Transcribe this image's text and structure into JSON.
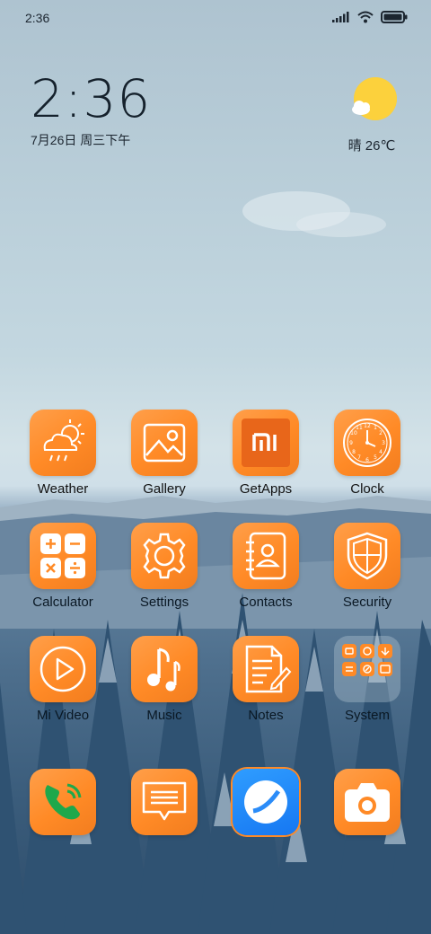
{
  "status_bar": {
    "time": "2:36",
    "icons": [
      "signal-icon",
      "wifi-icon",
      "battery-icon"
    ]
  },
  "clock_widget": {
    "time": "2:36",
    "date": "7月26日 周三下午"
  },
  "weather_widget": {
    "icon": "sun-cloud-icon",
    "text": "晴 26℃"
  },
  "apps": [
    {
      "label": "Weather",
      "icon": "weather-icon"
    },
    {
      "label": "Gallery",
      "icon": "gallery-icon"
    },
    {
      "label": "GetApps",
      "icon": "getapps-icon"
    },
    {
      "label": "Clock",
      "icon": "clock-icon"
    },
    {
      "label": "Calculator",
      "icon": "calculator-icon"
    },
    {
      "label": "Settings",
      "icon": "settings-icon"
    },
    {
      "label": "Contacts",
      "icon": "contacts-icon"
    },
    {
      "label": "Security",
      "icon": "security-icon"
    },
    {
      "label": "Mi Video",
      "icon": "video-icon"
    },
    {
      "label": "Music",
      "icon": "music-icon"
    },
    {
      "label": "Notes",
      "icon": "notes-icon"
    },
    {
      "label": "System",
      "icon": "system-folder-icon"
    }
  ],
  "dock": [
    {
      "icon": "phone-icon"
    },
    {
      "icon": "messages-icon"
    },
    {
      "icon": "browser-icon"
    },
    {
      "icon": "camera-icon"
    }
  ],
  "colors": {
    "tile_orange": "#ff8a26",
    "tile_highlight": "#ffa657",
    "text_dark": "#15212c"
  }
}
